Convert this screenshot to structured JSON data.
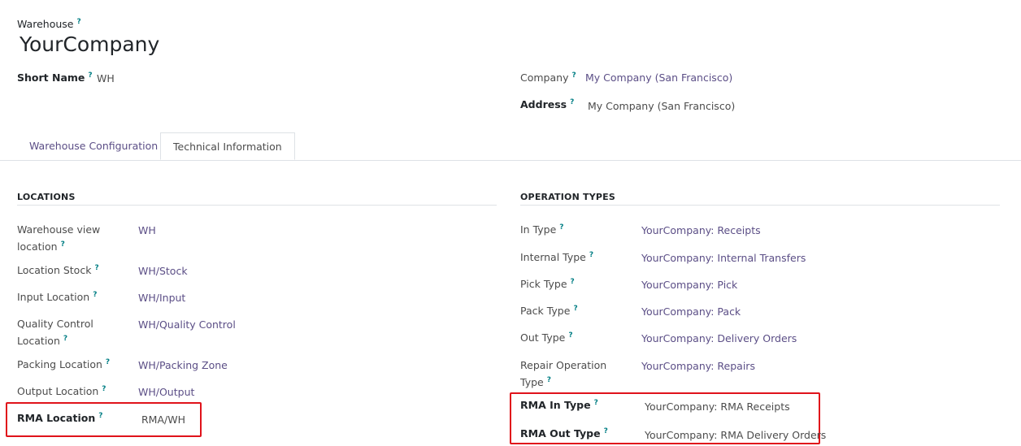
{
  "header": {
    "warehouse_label": "Warehouse",
    "warehouse_name": "YourCompany",
    "short_name_label": "Short Name",
    "short_name_value": "WH",
    "company_label": "Company",
    "company_value": "My Company (San Francisco)",
    "address_label": "Address",
    "address_value": "My Company (San Francisco)"
  },
  "help_mark": "?",
  "tabs": [
    {
      "label": "Warehouse Configuration",
      "active": false
    },
    {
      "label": "Technical Information",
      "active": true
    }
  ],
  "locations": {
    "title": "LOCATIONS",
    "rows": [
      {
        "label_line1": "Warehouse view",
        "label_line2": "location",
        "value": "WH"
      },
      {
        "label": "Location Stock",
        "value": "WH/Stock"
      },
      {
        "label": "Input Location",
        "value": "WH/Input"
      },
      {
        "label_line1": "Quality Control",
        "label_line2": "Location",
        "value": "WH/Quality Control"
      },
      {
        "label": "Packing Location",
        "value": "WH/Packing Zone"
      },
      {
        "label": "Output Location",
        "value": "WH/Output"
      },
      {
        "label": "RMA Location",
        "value": "RMA/WH"
      }
    ]
  },
  "operation_types": {
    "title": "OPERATION TYPES",
    "rows": [
      {
        "label": "In Type",
        "value": "YourCompany: Receipts"
      },
      {
        "label": "Internal Type",
        "value": "YourCompany: Internal Transfers"
      },
      {
        "label": "Pick Type",
        "value": "YourCompany: Pick"
      },
      {
        "label": "Pack Type",
        "value": "YourCompany: Pack"
      },
      {
        "label": "Out Type",
        "value": "YourCompany: Delivery Orders"
      },
      {
        "label_line1": "Repair Operation",
        "label_line2": "Type",
        "value": "YourCompany: Repairs"
      },
      {
        "label": "RMA In Type",
        "value": "YourCompany: RMA Receipts"
      },
      {
        "label": "RMA Out Type",
        "value": "YourCompany: RMA Delivery Orders"
      }
    ]
  },
  "colors": {
    "link": "#5b4e86",
    "help": "#017e84",
    "highlight": "#e0131b"
  }
}
